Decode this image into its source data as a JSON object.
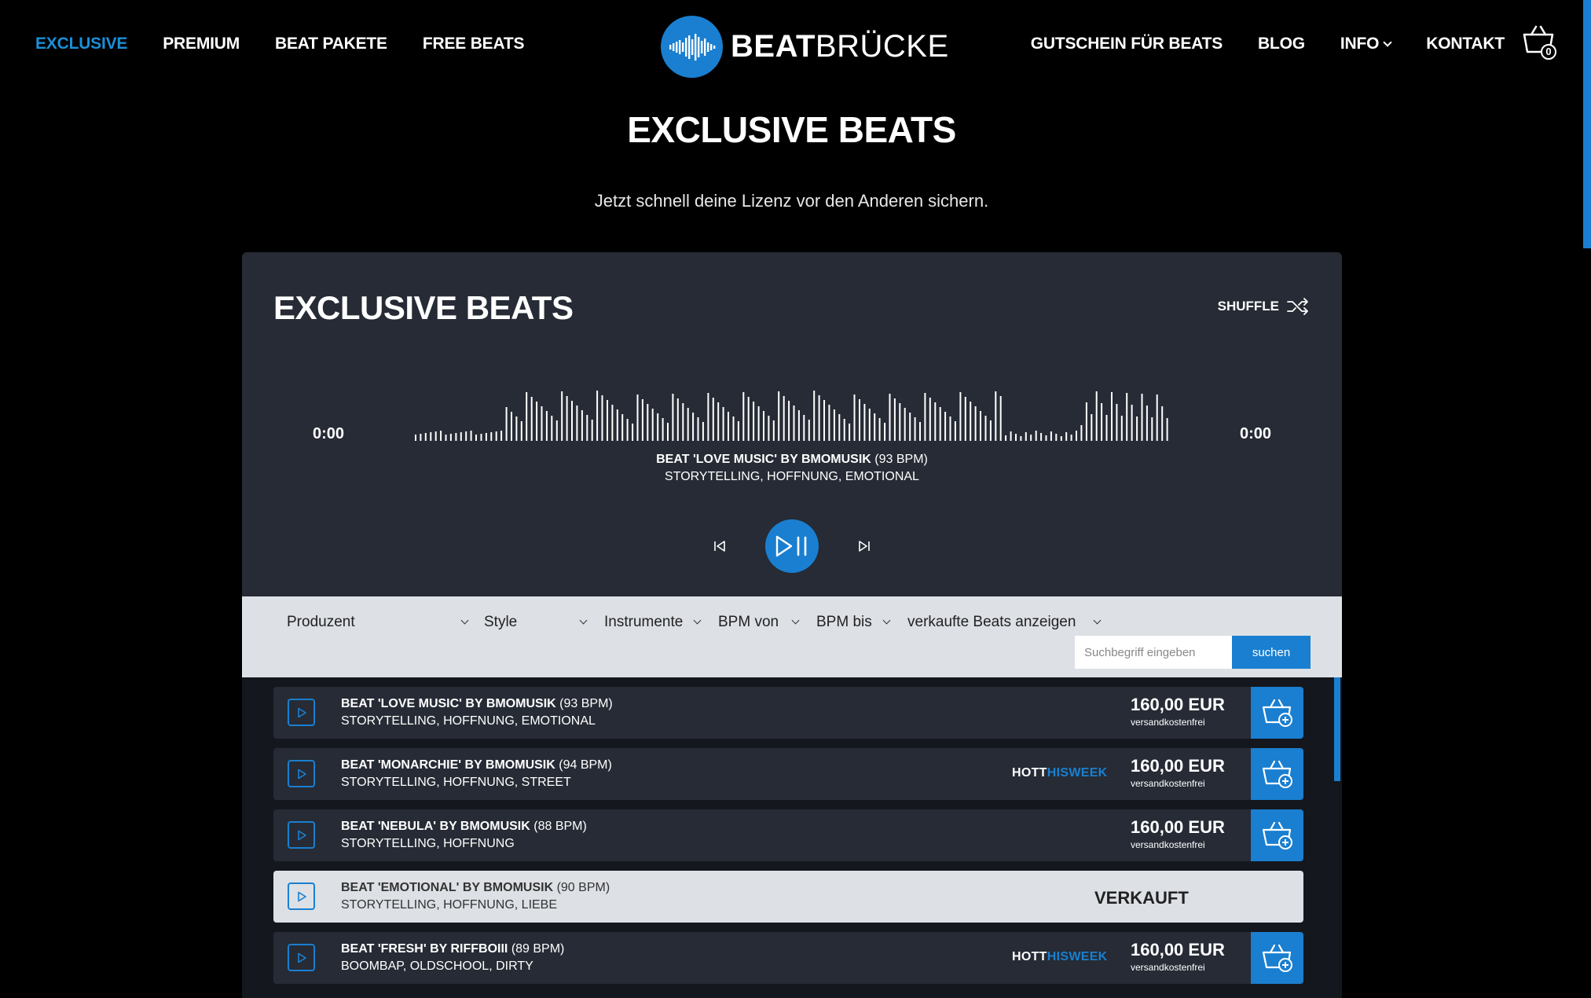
{
  "nav": {
    "left": [
      "EXCLUSIVE",
      "PREMIUM",
      "BEAT PAKETE",
      "FREE BEATS"
    ],
    "right": [
      "GUTSCHEIN FÜR BEATS",
      "BLOG",
      "INFO",
      "KONTAKT"
    ],
    "active_color": "#1b8fd8"
  },
  "logo": {
    "bold": "BEAT",
    "light": "BRÜCKE"
  },
  "cart": {
    "count": "0",
    "icon": "cart-icon"
  },
  "hero": {
    "title": "EXCLUSIVE BEATS",
    "subtitle": "Jetzt schnell deine Lizenz vor den Anderen sichern."
  },
  "player": {
    "title": "EXCLUSIVE BEATS",
    "shuffle_label": "SHUFFLE",
    "time_current": "0:00",
    "time_total": "0:00",
    "now_playing": {
      "title": "BEAT 'LOVE MUSIC' BY BMOMUSIK",
      "bpm": "(93 BPM)",
      "tags": "STORYTELLING, HOFFNUNG, EMOTIONAL"
    }
  },
  "filters": {
    "selects": [
      "Produzent",
      "Style",
      "Instrumente",
      "BPM von",
      "BPM bis",
      "verkaufte Beats anzeigen"
    ],
    "search_placeholder": "Suchbegriff eingeben",
    "search_button": "suchen"
  },
  "tracks": [
    {
      "title": "BEAT 'LOVE MUSIC' BY BMOMUSIK",
      "bpm": "(93 BPM)",
      "tags": "STORYTELLING, HOFFNUNG, EMOTIONAL",
      "hot": false,
      "sold": false,
      "price": "160,00 EUR",
      "note": "versandkostenfrei"
    },
    {
      "title": "BEAT 'MONARCHIE' BY BMOMUSIK",
      "bpm": "(94 BPM)",
      "tags": "STORYTELLING, HOFFNUNG, STREET",
      "hot": true,
      "sold": false,
      "price": "160,00 EUR",
      "note": "versandkostenfrei"
    },
    {
      "title": "BEAT 'NEBULA' BY BMOMUSIK",
      "bpm": "(88 BPM)",
      "tags": "STORYTELLING, HOFFNUNG",
      "hot": false,
      "sold": false,
      "price": "160,00 EUR",
      "note": "versandkostenfrei"
    },
    {
      "title": "BEAT 'EMOTIONAL' BY BMOMUSIK",
      "bpm": "(90 BPM)",
      "tags": "STORYTELLING, HOFFNUNG, LIEBE",
      "hot": false,
      "sold": true,
      "sold_label": "VERKAUFT"
    },
    {
      "title": "BEAT 'FRESH' BY RIFFBOIII",
      "bpm": "(89 BPM)",
      "tags": "BOOMBAP, OLDSCHOOL, DIRTY",
      "hot": true,
      "sold": false,
      "price": "160,00 EUR",
      "note": "versandkostenfrei"
    }
  ],
  "hot_badge": {
    "white": "HOTT",
    "blue": "HISWEEK"
  },
  "colors": {
    "accent": "#1a7fd0",
    "panel": "#262b35",
    "list_bg": "#14171d",
    "filter_bg": "#dde0e5"
  }
}
